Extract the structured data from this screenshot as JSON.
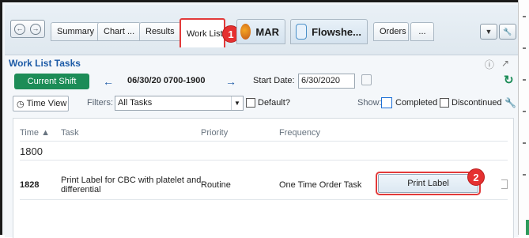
{
  "tabs": [
    {
      "label": "Summary"
    },
    {
      "label": "Chart ..."
    },
    {
      "label": "Results"
    },
    {
      "label": "Work List"
    },
    {
      "label": "MAR"
    },
    {
      "label": "Flowshe..."
    },
    {
      "label": "Orders"
    },
    {
      "label": "..."
    }
  ],
  "callouts": {
    "first": "1",
    "second": "2"
  },
  "panel": {
    "title": "Work List Tasks",
    "shift_button": "Current Shift",
    "shift_range": "06/30/20 0700-1900",
    "start_date_label": "Start Date:",
    "start_date_value": "6/30/2020",
    "time_view": "Time View",
    "filters_label": "Filters:",
    "filters_value": "All Tasks",
    "default_label": "Default?",
    "show_label": "Show:",
    "completed_label": "Completed",
    "discontinued_label": "Discontinued"
  },
  "table": {
    "headers": {
      "time": "Time",
      "task": "Task",
      "priority": "Priority",
      "frequency": "Frequency"
    },
    "group": "1800",
    "rows": [
      {
        "time": "1828",
        "task": "Print Label for CBC with platelet and differential",
        "priority": "Routine",
        "frequency": "One Time Order Task",
        "action": "Print Label"
      }
    ]
  },
  "colors": {
    "accent_green": "#1c8c57",
    "title_blue": "#1c5aa6",
    "callout_red": "#e53030"
  }
}
